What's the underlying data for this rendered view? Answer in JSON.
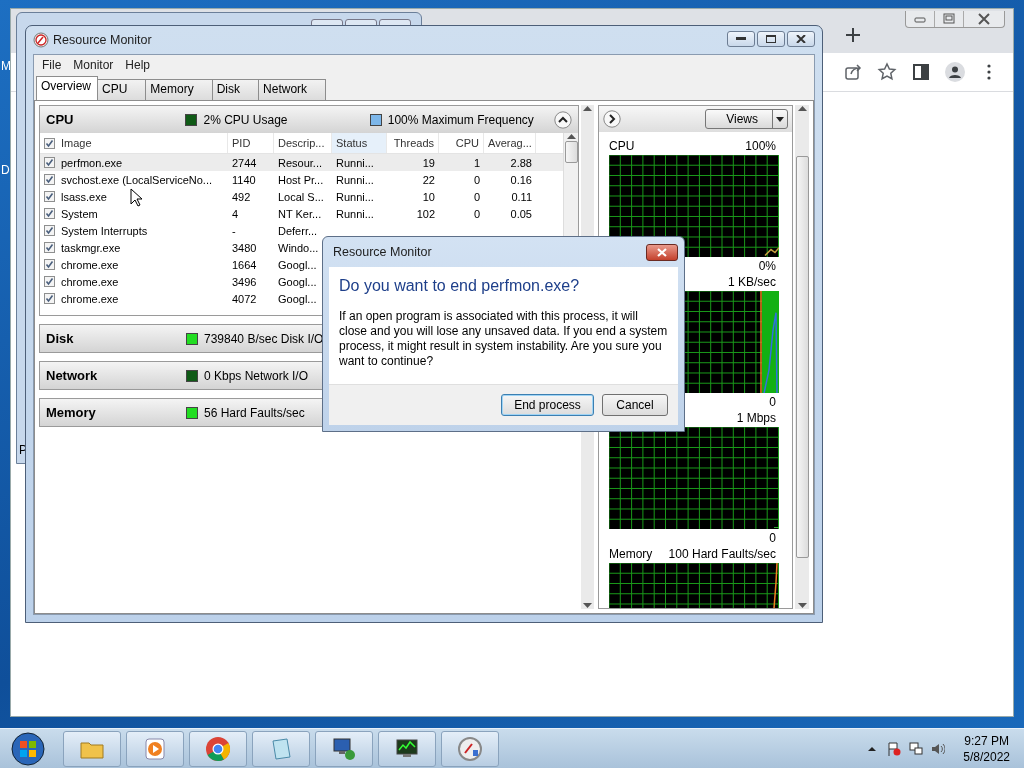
{
  "desktop": {
    "fragments": [
      "M",
      "D"
    ]
  },
  "background_window": {
    "fragment": "P"
  },
  "window": {
    "title": "Resource Monitor"
  },
  "menu": [
    "File",
    "Monitor",
    "Help"
  ],
  "tabs": [
    {
      "label": "Overview",
      "selected": true
    },
    {
      "label": "CPU",
      "selected": false
    },
    {
      "label": "Memory",
      "selected": false
    },
    {
      "label": "Disk",
      "selected": false
    },
    {
      "label": "Network",
      "selected": false
    }
  ],
  "cpu_section": {
    "title": "CPU",
    "expanded": true,
    "indicators": [
      {
        "text": "2% CPU Usage",
        "color": "#0f5a16"
      },
      {
        "text": "100% Maximum Frequency",
        "color": "#7db7ea"
      }
    ],
    "all_checked": true,
    "columns": [
      {
        "label": "Image",
        "sorted": false
      },
      {
        "label": "PID",
        "sorted": false
      },
      {
        "label": "Descrip...",
        "sorted": false
      },
      {
        "label": "Status",
        "sorted": true
      },
      {
        "label": "Threads",
        "sorted": false
      },
      {
        "label": "CPU",
        "sorted": false
      },
      {
        "label": "Averag...",
        "sorted": false
      }
    ],
    "rows": [
      {
        "checked": true,
        "selected": true,
        "cells": [
          "perfmon.exe",
          "2744",
          "Resour...",
          "Runni...",
          "19",
          "1",
          "2.88"
        ]
      },
      {
        "checked": true,
        "selected": false,
        "cells": [
          "svchost.exe (LocalServiceNo...",
          "1140",
          "Host Pr...",
          "Runni...",
          "22",
          "0",
          "0.16"
        ]
      },
      {
        "checked": true,
        "selected": false,
        "cells": [
          "lsass.exe",
          "492",
          "Local S...",
          "Runni...",
          "10",
          "0",
          "0.11"
        ]
      },
      {
        "checked": true,
        "selected": false,
        "cells": [
          "System",
          "4",
          "NT Ker...",
          "Runni...",
          "102",
          "0",
          "0.05"
        ]
      },
      {
        "checked": true,
        "selected": false,
        "cells": [
          "System Interrupts",
          "-",
          "Deferr..."
        ]
      },
      {
        "checked": true,
        "selected": false,
        "cells": [
          "taskmgr.exe",
          "3480",
          "Windo..."
        ]
      },
      {
        "checked": true,
        "selected": false,
        "cells": [
          "chrome.exe",
          "1664",
          "Googl..."
        ]
      },
      {
        "checked": true,
        "selected": false,
        "cells": [
          "chrome.exe",
          "3496",
          "Googl..."
        ]
      },
      {
        "checked": true,
        "selected": false,
        "cells": [
          "chrome.exe",
          "4072",
          "Googl..."
        ]
      }
    ]
  },
  "other_sections": [
    {
      "title": "Disk",
      "indicator": {
        "text": "739840 B/sec Disk I/O",
        "color": "#22dd22"
      }
    },
    {
      "title": "Network",
      "indicator": {
        "text": "0 Kbps Network I/O",
        "color": "#0f5a16"
      }
    },
    {
      "title": "Memory",
      "indicator": {
        "text": "56 Hard Faults/sec",
        "color": "#22dd22"
      }
    }
  ],
  "graph_panel": {
    "views_button": "Views",
    "graphs": [
      {
        "title": "CPU",
        "max": "100%",
        "min": "0%"
      },
      {
        "max": "1 KB/sec",
        "min": "0"
      },
      {
        "max": "1 Mbps",
        "min": "0"
      },
      {
        "title": "Memory",
        "max": "100 Hard Faults/sec"
      }
    ]
  },
  "dialog": {
    "title": "Resource Monitor",
    "heading": "Do you want to end perfmon.exe?",
    "message": "If an open program is associated with this process, it will close and you will lose any unsaved data. If you end a system process, it might result in system instability. Are you sure you want to continue?",
    "buttons": [
      {
        "label": "End process",
        "default": true
      },
      {
        "label": "Cancel",
        "default": false
      }
    ]
  },
  "taskbar": {
    "time": "9:27 PM",
    "date": "5/8/2022"
  }
}
